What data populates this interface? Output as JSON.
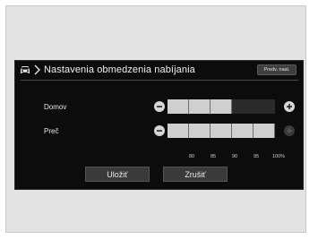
{
  "header": {
    "title": "Nastavenia obmedzenia nabíjania",
    "defaults_label": "Predv. nast."
  },
  "rows": [
    {
      "label": "Domov",
      "level_percent": 90
    },
    {
      "label": "Preč",
      "level_percent": 100
    }
  ],
  "scale_ticks": [
    "80",
    "85",
    "90",
    "95",
    "100%"
  ],
  "buttons": {
    "save_label": "Uložiť",
    "cancel_label": "Zrušiť"
  },
  "colors": {
    "background": "#0c0c0c",
    "segment_on": "#cfcfcf",
    "segment_off": "#2a2a2a"
  },
  "icons": [
    "car-icon",
    "chevron-right-icon",
    "minus-icon",
    "plus-icon"
  ]
}
